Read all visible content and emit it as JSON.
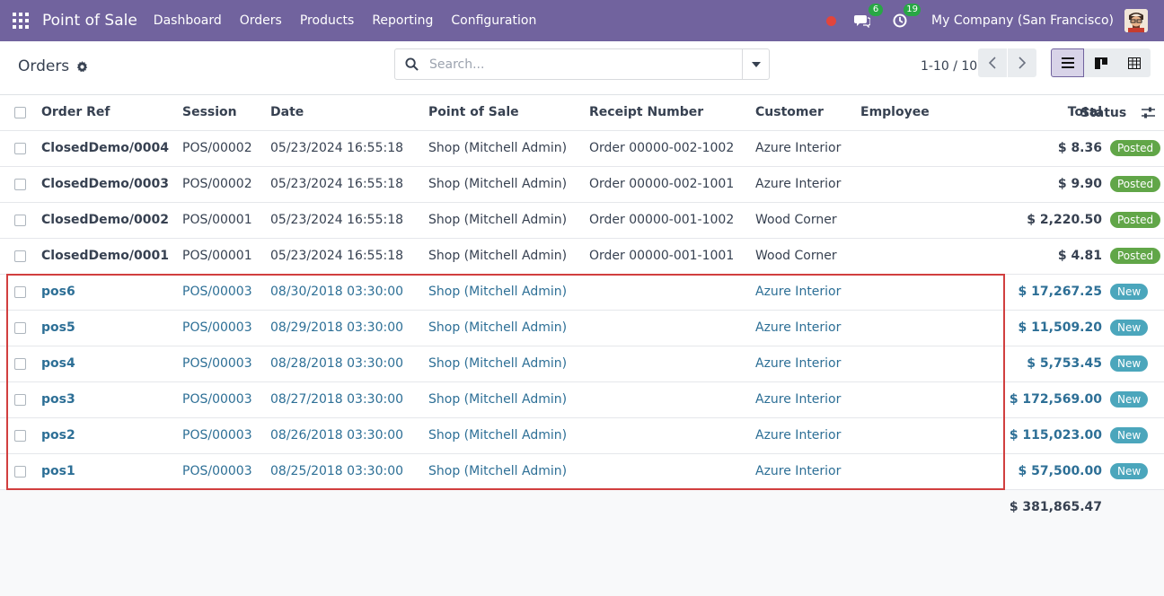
{
  "navbar": {
    "brand": "Point of Sale",
    "menu": [
      "Dashboard",
      "Orders",
      "Products",
      "Reporting",
      "Configuration"
    ],
    "messages_count": "6",
    "activities_count": "19",
    "company": "My Company (San Francisco)",
    "icons": [
      "apps-grid-icon",
      "record-icon",
      "chat-icon",
      "clock-icon"
    ],
    "bg_color": "#71639e"
  },
  "control": {
    "title": "Orders",
    "search_placeholder": "Search...",
    "pager": "1-10 / 10"
  },
  "table": {
    "headers": {
      "order_ref": "Order Ref",
      "session": "Session",
      "date": "Date",
      "pos": "Point of Sale",
      "receipt": "Receipt Number",
      "customer": "Customer",
      "employee": "Employee",
      "total": "Total",
      "status": "Status"
    },
    "rows": [
      {
        "ref": "ClosedDemo/0004",
        "session": "POS/00002",
        "date": "05/23/2024 16:55:18",
        "pos": "Shop (Mitchell Admin)",
        "receipt": "Order 00000-002-1002",
        "customer": "Azure Interior",
        "employee": "",
        "total": "$ 8.36",
        "status": "Posted",
        "kind": "posted"
      },
      {
        "ref": "ClosedDemo/0003",
        "session": "POS/00002",
        "date": "05/23/2024 16:55:18",
        "pos": "Shop (Mitchell Admin)",
        "receipt": "Order 00000-002-1001",
        "customer": "Azure Interior",
        "employee": "",
        "total": "$ 9.90",
        "status": "Posted",
        "kind": "posted"
      },
      {
        "ref": "ClosedDemo/0002",
        "session": "POS/00001",
        "date": "05/23/2024 16:55:18",
        "pos": "Shop (Mitchell Admin)",
        "receipt": "Order 00000-001-1002",
        "customer": "Wood Corner",
        "employee": "",
        "total": "$ 2,220.50",
        "status": "Posted",
        "kind": "posted"
      },
      {
        "ref": "ClosedDemo/0001",
        "session": "POS/00001",
        "date": "05/23/2024 16:55:18",
        "pos": "Shop (Mitchell Admin)",
        "receipt": "Order 00000-001-1001",
        "customer": "Wood Corner",
        "employee": "",
        "total": "$ 4.81",
        "status": "Posted",
        "kind": "posted"
      },
      {
        "ref": "pos6",
        "session": "POS/00003",
        "date": "08/30/2018 03:30:00",
        "pos": "Shop (Mitchell Admin)",
        "receipt": "",
        "customer": "Azure Interior",
        "employee": "",
        "total": "$ 17,267.25",
        "status": "New",
        "kind": "new"
      },
      {
        "ref": "pos5",
        "session": "POS/00003",
        "date": "08/29/2018 03:30:00",
        "pos": "Shop (Mitchell Admin)",
        "receipt": "",
        "customer": "Azure Interior",
        "employee": "",
        "total": "$ 11,509.20",
        "status": "New",
        "kind": "new"
      },
      {
        "ref": "pos4",
        "session": "POS/00003",
        "date": "08/28/2018 03:30:00",
        "pos": "Shop (Mitchell Admin)",
        "receipt": "",
        "customer": "Azure Interior",
        "employee": "",
        "total": "$ 5,753.45",
        "status": "New",
        "kind": "new"
      },
      {
        "ref": "pos3",
        "session": "POS/00003",
        "date": "08/27/2018 03:30:00",
        "pos": "Shop (Mitchell Admin)",
        "receipt": "",
        "customer": "Azure Interior",
        "employee": "",
        "total": "$ 172,569.00",
        "status": "New",
        "kind": "new"
      },
      {
        "ref": "pos2",
        "session": "POS/00003",
        "date": "08/26/2018 03:30:00",
        "pos": "Shop (Mitchell Admin)",
        "receipt": "",
        "customer": "Azure Interior",
        "employee": "",
        "total": "$ 115,023.00",
        "status": "New",
        "kind": "new"
      },
      {
        "ref": "pos1",
        "session": "POS/00003",
        "date": "08/25/2018 03:30:00",
        "pos": "Shop (Mitchell Admin)",
        "receipt": "",
        "customer": "Azure Interior",
        "employee": "",
        "total": "$ 57,500.00",
        "status": "New",
        "kind": "new"
      }
    ],
    "grand_total": "$ 381,865.47"
  },
  "colors": {
    "posted": "#61a648",
    "new": "#4ba6bc",
    "link": "#2d6f96",
    "highlight": "#d13f3f"
  }
}
